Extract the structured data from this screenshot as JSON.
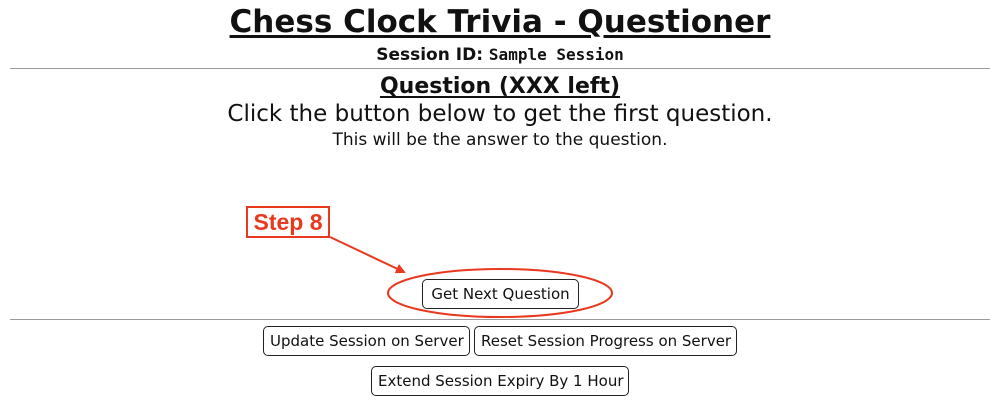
{
  "page": {
    "title": "Chess Clock Trivia - Questioner",
    "session_label": "Session ID:",
    "session_id": "Sample Session"
  },
  "question": {
    "heading": "Question (XXX left)",
    "text": "Click the button below to get the first question.",
    "answer": "This will be the answer to the question."
  },
  "buttons": {
    "next_question": "Get Next Question",
    "update_session": "Update Session on Server",
    "reset_session": "Reset Session Progress on Server",
    "extend_expiry": "Extend Session Expiry By 1 Hour"
  },
  "annotation": {
    "step_label": "Step 8",
    "color": "#e8381e"
  }
}
